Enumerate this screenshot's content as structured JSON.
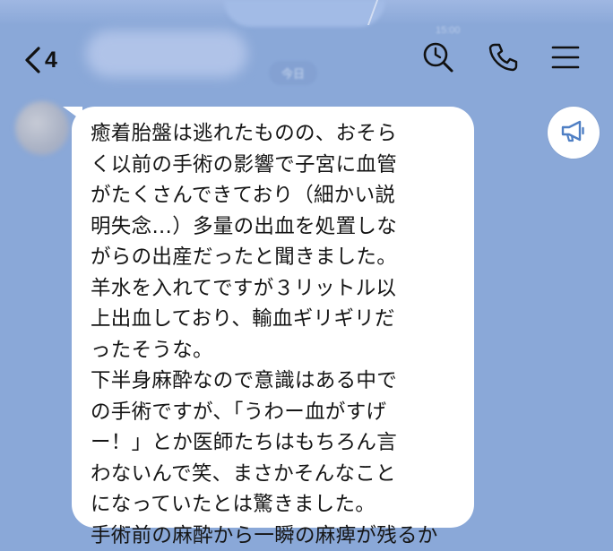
{
  "header": {
    "back_count": "4",
    "chat_title": "",
    "date_label": "今日",
    "time_label": "15:00"
  },
  "icons": {
    "back": "chevron-left-icon",
    "search": "search-icon",
    "call": "phone-icon",
    "menu": "menu-icon",
    "announce": "megaphone-icon"
  },
  "colors": {
    "background": "#8aa8d8",
    "bubble": "#ffffff",
    "text": "#151515",
    "icon": "#111111",
    "announce_icon": "#4f7fc4"
  },
  "message": {
    "lines": [
      "癒着胎盤は逃れたものの、おそら",
      "く以前の手術の影響で子宮に血管",
      "がたくさんできており（細かい説",
      "明失念…）多量の出血を処置しな",
      "がらの出産だったと聞きました。",
      "羊水を入れてですが３リットル以",
      "上出血しており、輸血ギリギリだ",
      "ったそうな。",
      "下半身麻酔なので意識はある中で",
      "の手術ですが、「うわー血がすげ",
      "ー！」とか医師たちはもちろん言",
      "わないんで笑、まさかそんなこと",
      "になっていたとは驚きました。",
      "手術前の麻酔から一瞬の麻痺が残るか"
    ]
  }
}
